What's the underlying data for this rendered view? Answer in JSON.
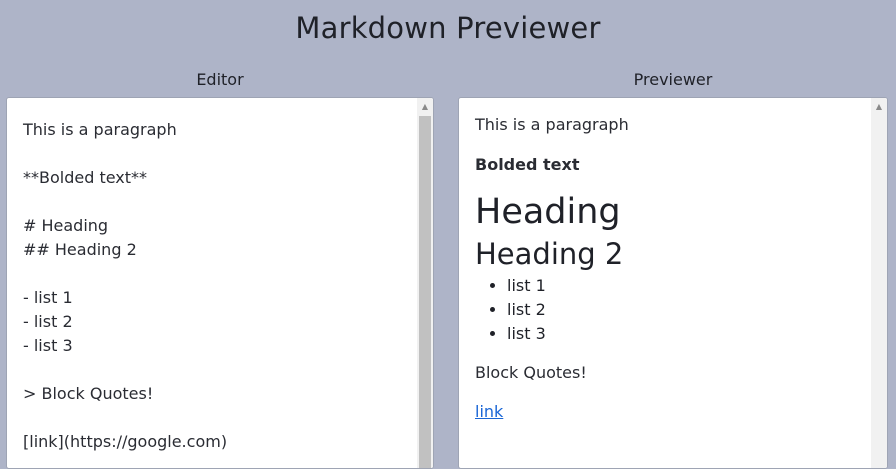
{
  "app": {
    "title": "Markdown Previewer"
  },
  "editor": {
    "label": "Editor",
    "content": "This is a paragraph\n\n**Bolded text**\n\n# Heading\n## Heading 2\n\n- list 1\n- list 2\n- list 3\n\n> Block Quotes!\n\n[link](https://google.com)"
  },
  "previewer": {
    "label": "Previewer",
    "paragraph": "This is a paragraph",
    "bold": "Bolded text",
    "heading1": "Heading",
    "heading2": "Heading 2",
    "list": [
      "list 1",
      "list 2",
      "list 3"
    ],
    "blockquote": "Block Quotes!",
    "link": {
      "text": "link"
    }
  },
  "icons": {
    "scroll_up": "scroll-up-arrow-icon"
  }
}
